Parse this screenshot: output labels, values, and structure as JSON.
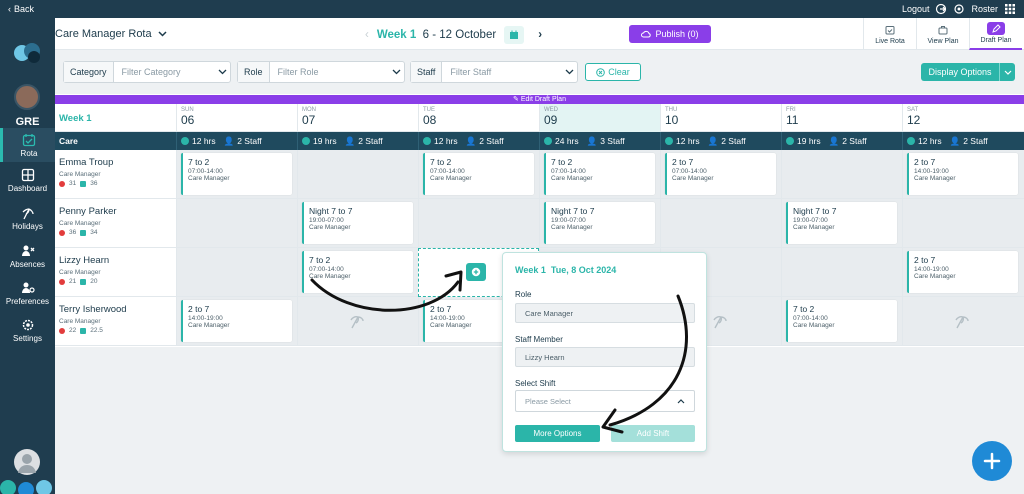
{
  "topbar": {
    "back_label": "Back",
    "logout_label": "Logout",
    "roster_label": "Roster"
  },
  "sidebar": {
    "org": "GRE",
    "items": [
      {
        "label": "Rota",
        "icon": "calendar-icon",
        "active": true
      },
      {
        "label": "Dashboard",
        "icon": "dashboard-icon"
      },
      {
        "label": "Holidays",
        "icon": "holiday-icon"
      },
      {
        "label": "Absences",
        "icon": "absence-icon"
      },
      {
        "label": "Preferences",
        "icon": "preferences-icon"
      },
      {
        "label": "Settings",
        "icon": "gear-icon"
      }
    ]
  },
  "header": {
    "rota_name": "Care Manager Rota",
    "week_label": "Week 1",
    "date_range": "6 - 12 October",
    "publish_label": "Publish (0)",
    "view_tabs": [
      "Live Rota",
      "View Plan",
      "Draft Plan"
    ]
  },
  "filters": {
    "category_label": "Category",
    "category_placeholder": "Filter Category",
    "role_label": "Role",
    "role_placeholder": "Filter Role",
    "staff_label": "Staff",
    "staff_placeholder": "Filter Staff",
    "clear_label": "Clear",
    "display_options_label": "Display Options"
  },
  "edit_banner": "Edit Draft Plan",
  "grid": {
    "week_label": "Week 1",
    "section_label": "Care",
    "days": [
      {
        "name": "SUN",
        "date": "06",
        "hrs": "12 hrs",
        "staff": "2 Staff"
      },
      {
        "name": "MON",
        "date": "07",
        "hrs": "19 hrs",
        "staff": "2 Staff"
      },
      {
        "name": "TUE",
        "date": "08",
        "hrs": "12 hrs",
        "staff": "2 Staff"
      },
      {
        "name": "WED",
        "date": "09",
        "hrs": "24 hrs",
        "staff": "3 Staff"
      },
      {
        "name": "THU",
        "date": "10",
        "hrs": "12 hrs",
        "staff": "2 Staff"
      },
      {
        "name": "FRI",
        "date": "11",
        "hrs": "19 hrs",
        "staff": "2 Staff"
      },
      {
        "name": "SAT",
        "date": "12",
        "hrs": "12 hrs",
        "staff": "2 Staff"
      }
    ],
    "staff": [
      {
        "name": "Emma Troup",
        "role": "Care Manager",
        "red": "31",
        "green": "36"
      },
      {
        "name": "Penny Parker",
        "role": "Care Manager",
        "red": "36",
        "green": "34"
      },
      {
        "name": "Lizzy Hearn",
        "role": "Care Manager",
        "red": "21",
        "green": "20"
      },
      {
        "name": "Terry Isherwood",
        "role": "Care Manager",
        "red": "22",
        "green": "22.5"
      }
    ],
    "shifts": {
      "s2to7": {
        "title": "2 to 7",
        "time": "14:00-19:00",
        "role": "Care Manager"
      },
      "s7to2": {
        "title": "7 to 2",
        "time": "07:00-14:00",
        "role": "Care Manager"
      },
      "night": {
        "title": "Night 7 to 7",
        "time": "19:00-07:00",
        "role": "Care Manager"
      }
    }
  },
  "popup": {
    "week": "Week 1",
    "date": "Tue, 8 Oct 2024",
    "role_label": "Role",
    "role_value": "Care Manager",
    "staff_label": "Staff Member",
    "staff_value": "Lizzy Hearn",
    "shift_label": "Select Shift",
    "shift_placeholder": "Please Select",
    "more_label": "More Options",
    "add_label": "Add Shift"
  }
}
